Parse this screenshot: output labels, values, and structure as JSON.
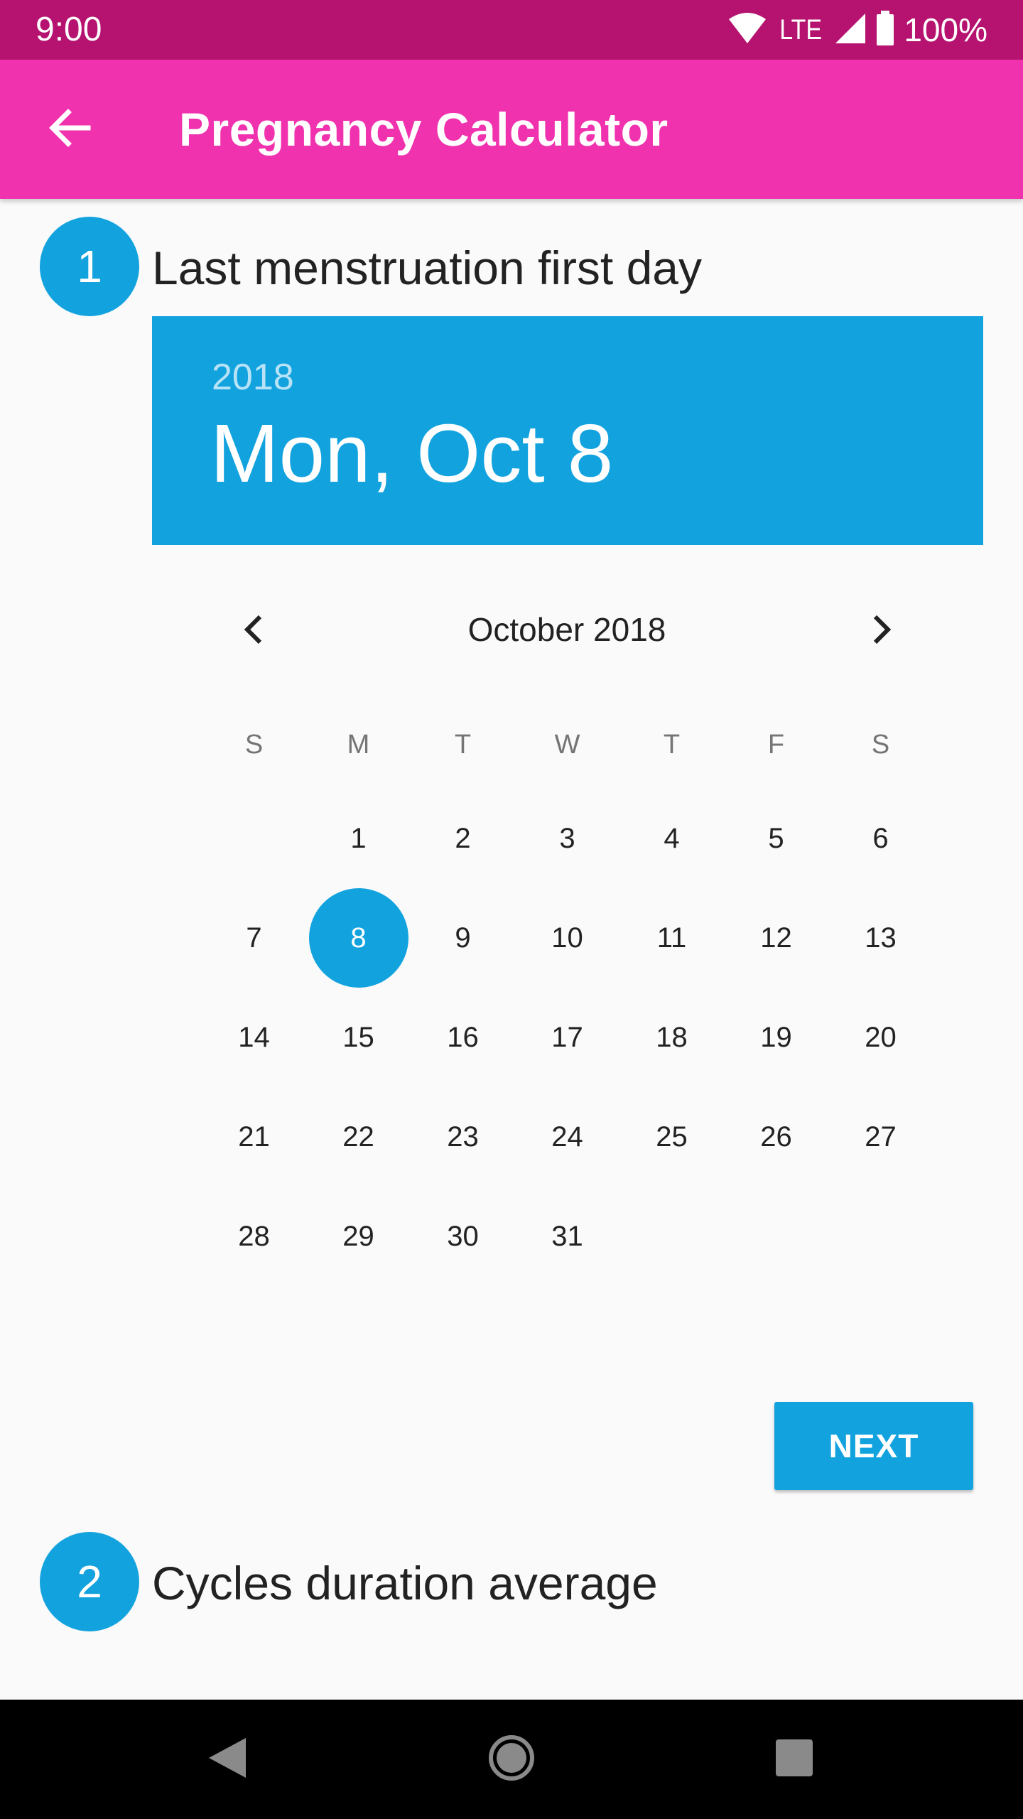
{
  "status_bar": {
    "time": "9:00",
    "network": "LTE",
    "battery": "100%"
  },
  "app_bar": {
    "title": "Pregnancy Calculator"
  },
  "step1": {
    "number": "1",
    "title": "Last menstruation first day"
  },
  "date_header": {
    "year": "2018",
    "date": "Mon, Oct 8"
  },
  "calendar": {
    "month_label": "October 2018",
    "weekdays": [
      "S",
      "M",
      "T",
      "W",
      "T",
      "F",
      "S"
    ],
    "weeks": [
      [
        "",
        "1",
        "2",
        "3",
        "4",
        "5",
        "6"
      ],
      [
        "7",
        "8",
        "9",
        "10",
        "11",
        "12",
        "13"
      ],
      [
        "14",
        "15",
        "16",
        "17",
        "18",
        "19",
        "20"
      ],
      [
        "21",
        "22",
        "23",
        "24",
        "25",
        "26",
        "27"
      ],
      [
        "28",
        "29",
        "30",
        "31",
        "",
        "",
        ""
      ]
    ],
    "selected": "8"
  },
  "next_button": {
    "label": "NEXT"
  },
  "step2": {
    "number": "2",
    "title": "Cycles duration average"
  },
  "colors": {
    "status_bar": "#b5136f",
    "app_bar": "#f032ae",
    "accent": "#12a3df"
  },
  "icons": {
    "back": "arrow-left-icon",
    "prev": "chevron-left-icon",
    "next": "chevron-right-icon"
  }
}
